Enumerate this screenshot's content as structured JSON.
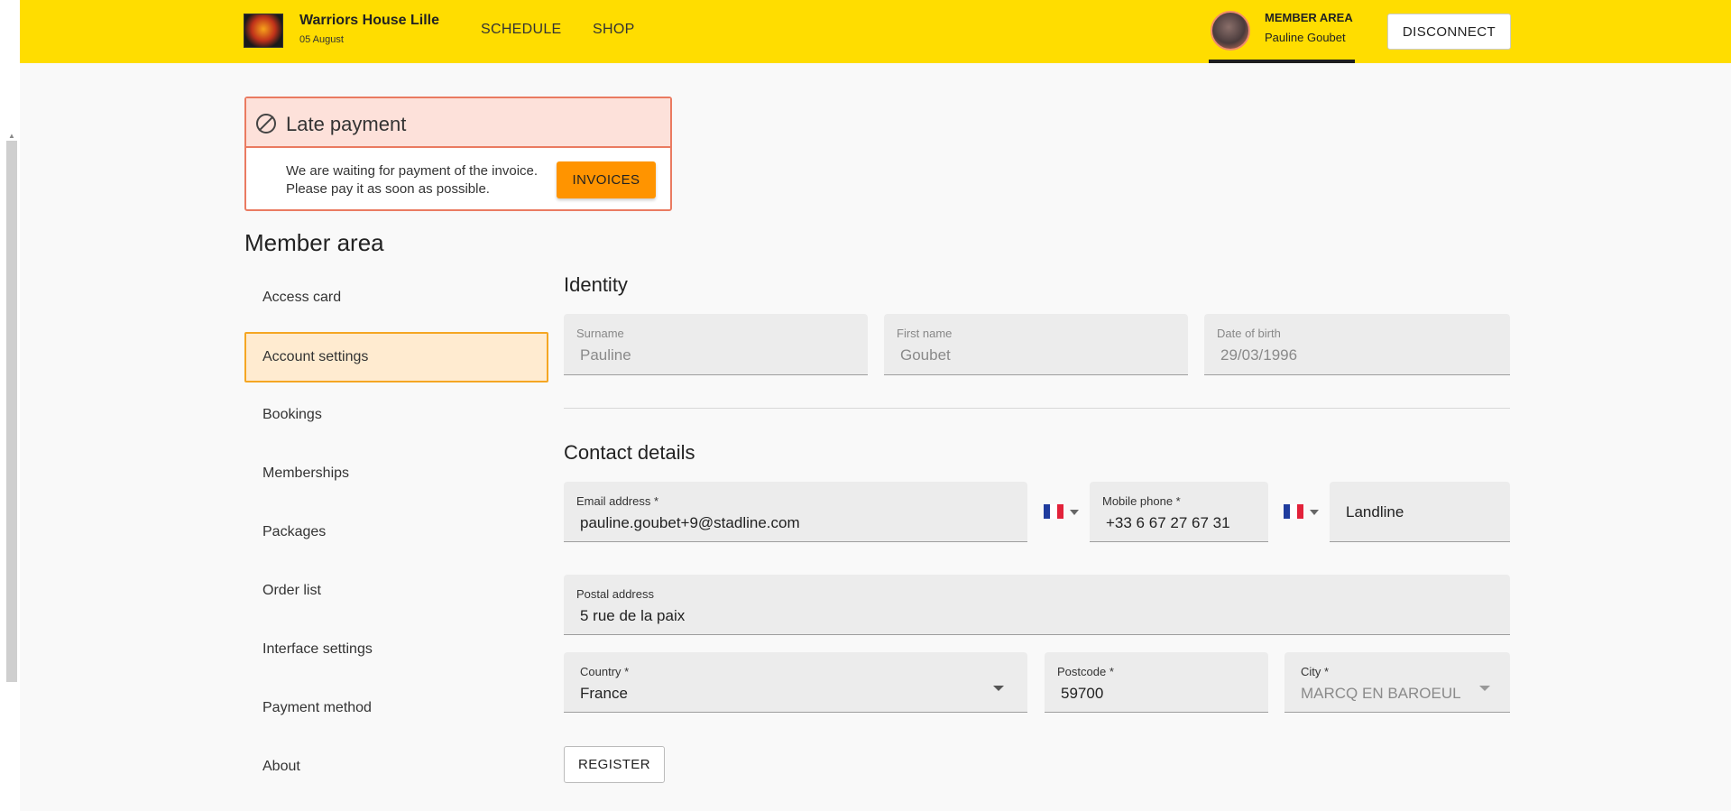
{
  "header": {
    "club_name": "Warriors House Lille",
    "date": "05 August",
    "nav": {
      "schedule": "SCHEDULE",
      "shop": "SHOP"
    },
    "member_area_label": "MEMBER AREA",
    "member_name": "Pauline Goubet",
    "disconnect": "DISCONNECT",
    "accent_color": "#ffdd00"
  },
  "alert": {
    "title": "Late payment",
    "line1": "We are waiting for payment of the invoice.",
    "line2": "Please pay it as soon as possible.",
    "button": "INVOICES",
    "icon": "no-entry-icon"
  },
  "sidebar": {
    "title": "Member area",
    "items": [
      {
        "label": "Access card"
      },
      {
        "label": "Account settings",
        "active": true
      },
      {
        "label": "Bookings"
      },
      {
        "label": "Memberships"
      },
      {
        "label": "Packages"
      },
      {
        "label": "Order list"
      },
      {
        "label": "Interface settings"
      },
      {
        "label": "Payment method"
      },
      {
        "label": "About"
      }
    ]
  },
  "identity": {
    "title": "Identity",
    "surname": {
      "label": "Surname",
      "value": "Pauline"
    },
    "first_name": {
      "label": "First name",
      "value": "Goubet"
    },
    "dob": {
      "label": "Date of birth",
      "value": "29/03/1996"
    }
  },
  "contact": {
    "title": "Contact details",
    "email": {
      "label": "Email address *",
      "value": "pauline.goubet+9@stadline.com"
    },
    "mobile": {
      "label": "Mobile phone *",
      "value": "+33 6 67 27 67 31"
    },
    "landline": {
      "placeholder": "Landline"
    },
    "postal": {
      "label": "Postal address",
      "value": "5 rue de la paix"
    },
    "country": {
      "label": "Country *",
      "value": "France"
    },
    "postcode": {
      "label": "Postcode *",
      "value": "59700"
    },
    "city": {
      "label": "City *",
      "value": "MARCQ EN BAROEUL"
    }
  },
  "register": "REGISTER"
}
